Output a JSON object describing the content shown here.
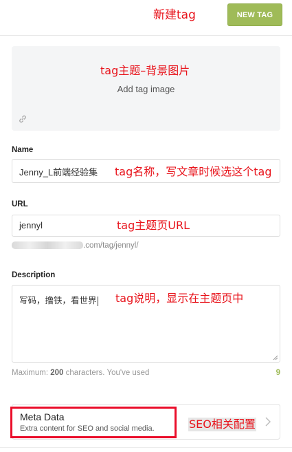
{
  "header": {
    "title_annotation": "新建tag",
    "new_tag_label": "NEW TAG"
  },
  "image_upload": {
    "annotation": "tag主题–背景图片",
    "label": "Add tag image",
    "icon": "link-icon"
  },
  "name_field": {
    "label": "Name",
    "value": "Jenny_L前端经验集",
    "annotation": "tag名称，写文章时候选这个tag"
  },
  "url_field": {
    "label": "URL",
    "value": "jennyl",
    "annotation": "tag主题页URL",
    "preview_suffix": ".com/tag/jennyl/"
  },
  "description_field": {
    "label": "Description",
    "value": "写码，撸铁，看世界",
    "annotation": "tag说明，显示在主题页中",
    "counter_prefix": "Maximum:",
    "counter_max": "200",
    "counter_suffix": "characters. You've used",
    "counter_used": "9"
  },
  "meta_data": {
    "title": "Meta Data",
    "description": "Extra content for SEO and social media.",
    "annotation": "SEO相关配置",
    "icon": "chevron-right-icon"
  },
  "colors": {
    "accent_green": "#9fbb58",
    "annotation_red": "#e8141c",
    "highlight_red": "#ea0d2a"
  }
}
